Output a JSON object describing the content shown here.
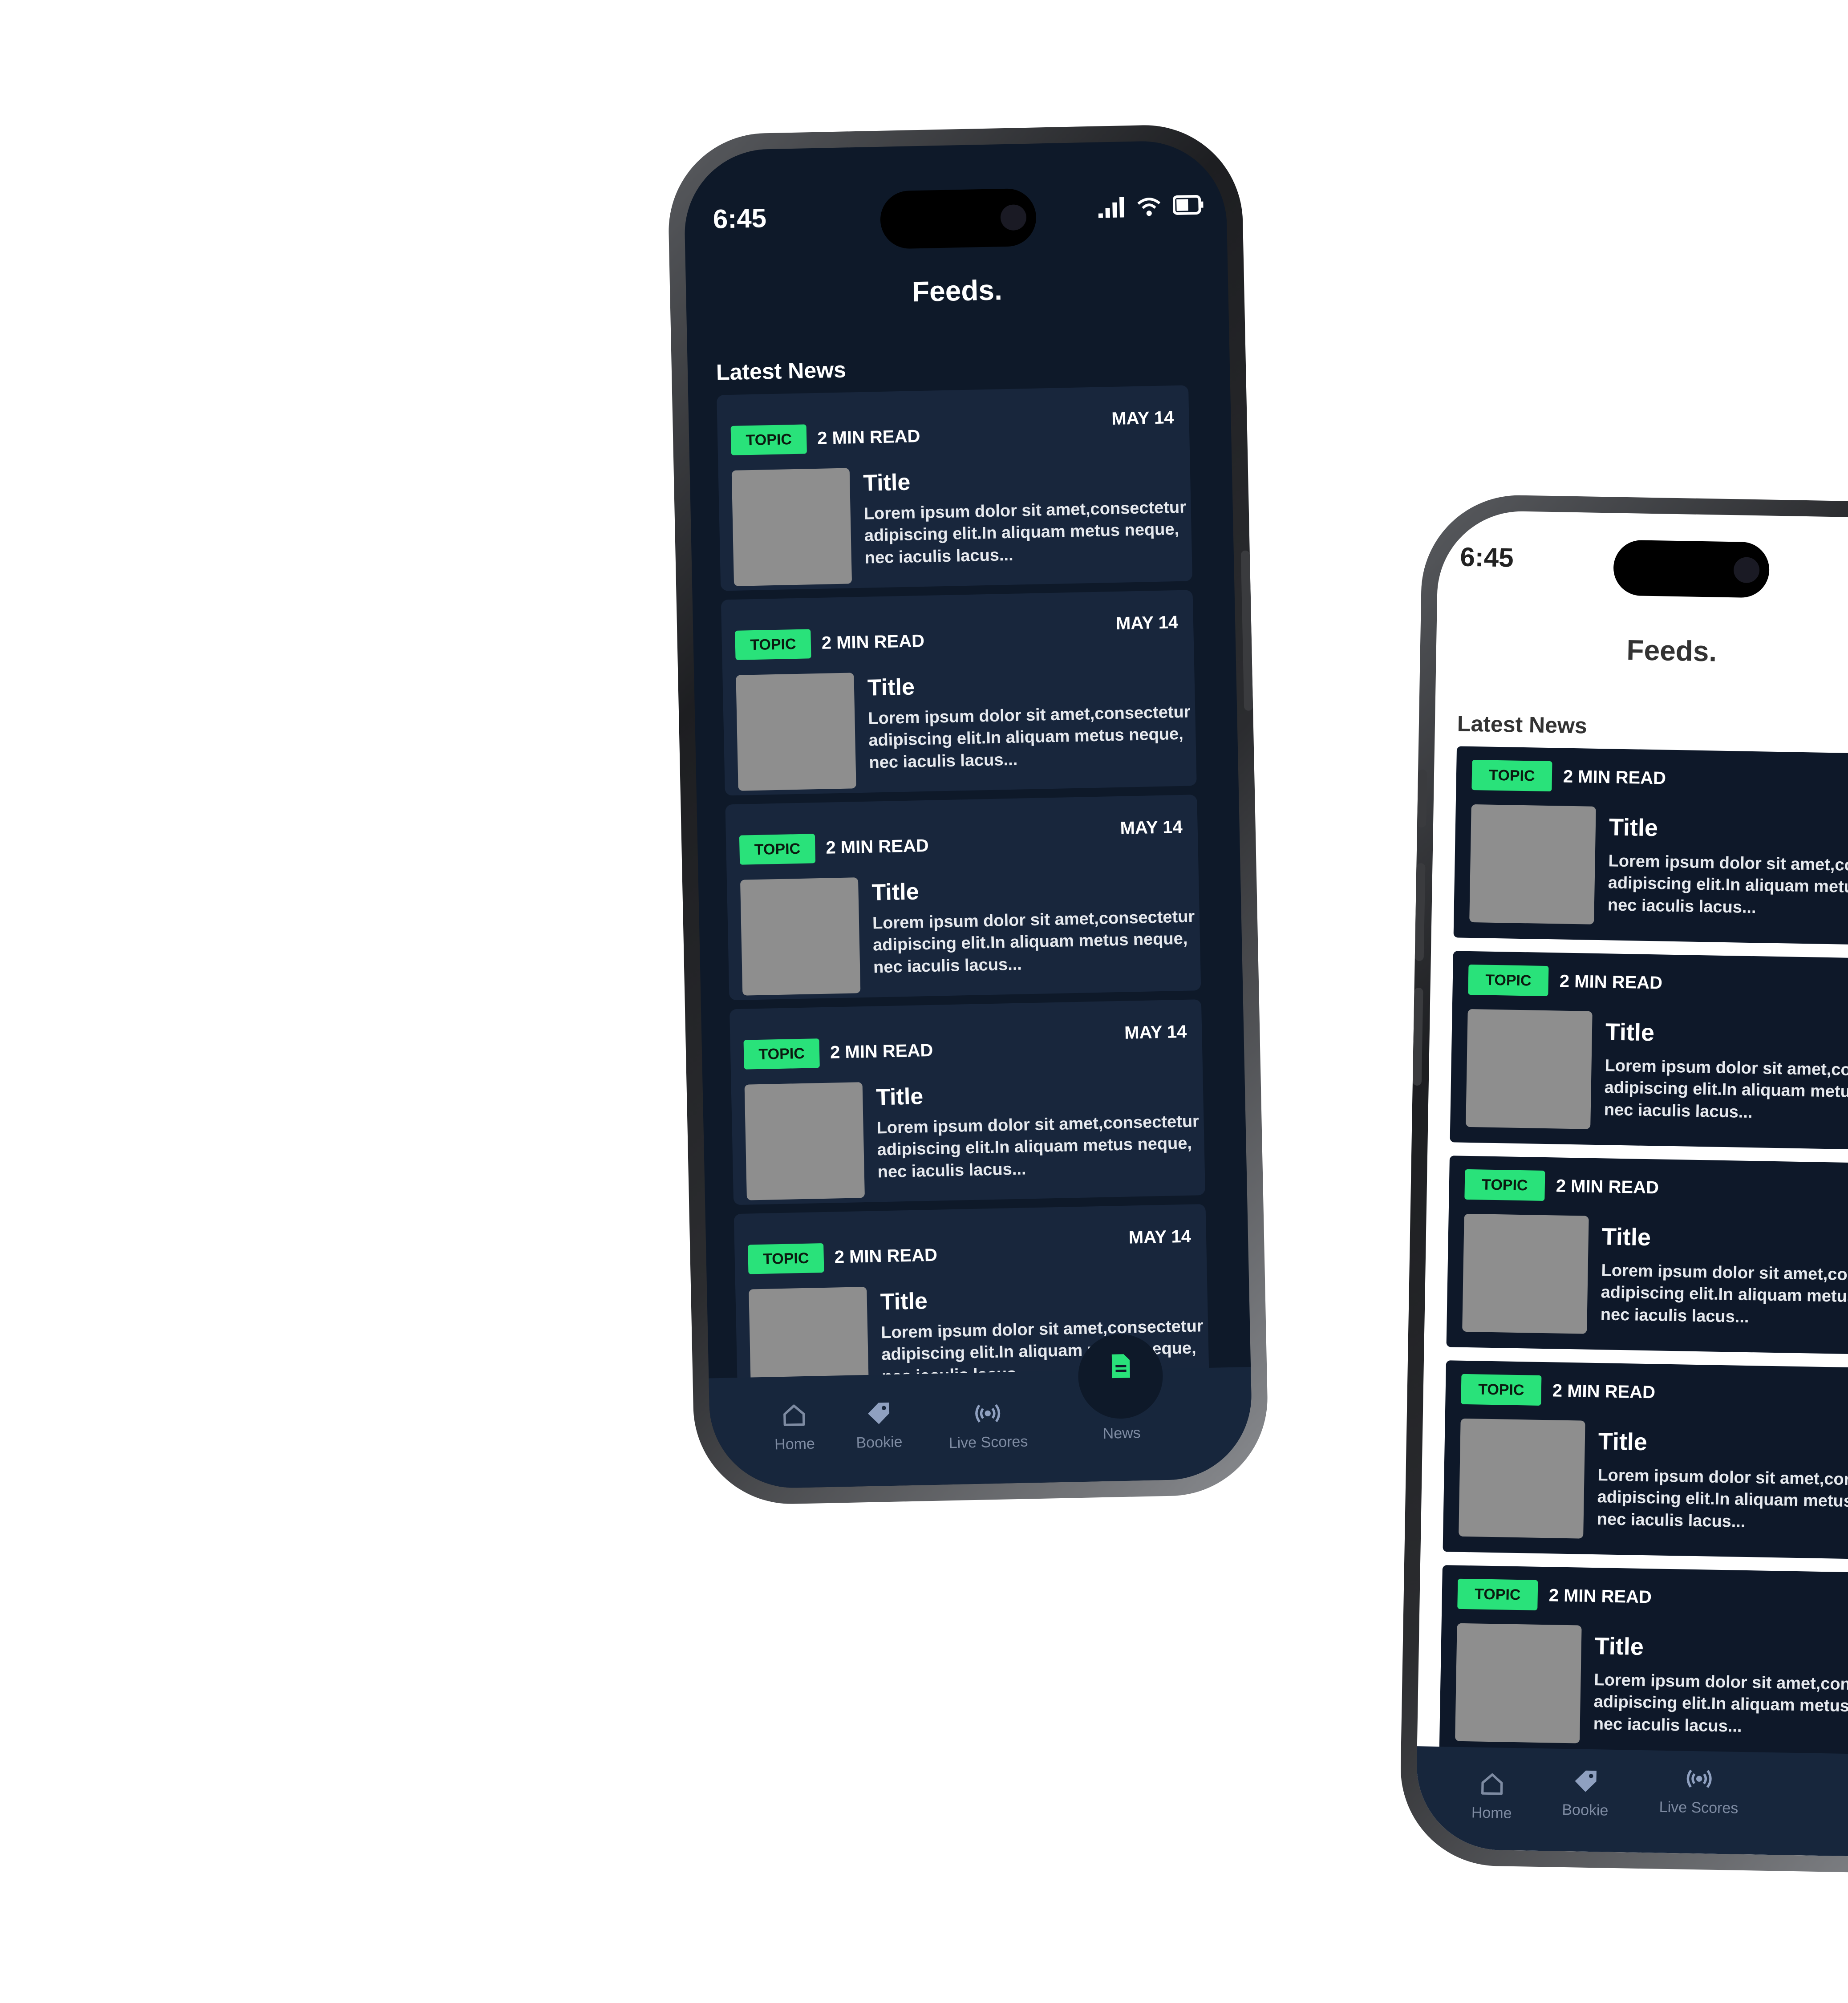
{
  "colors": {
    "screen_bg": "#0f1a2b",
    "card_bg": "#18263c",
    "topic_bg": "#29e27a",
    "nav_text": "#7e8ba2",
    "nav_active": "#29e27a"
  },
  "status": {
    "time": "6:45"
  },
  "app": {
    "title": "Feeds.",
    "section": "Latest News"
  },
  "article": {
    "topic": "TOPIC",
    "read": "2 MIN READ",
    "date": "MAY 14",
    "title": "Title",
    "desc_line1": "Lorem ipsum dolor sit amet,consectetur",
    "desc_line2": "adipiscing  elit.In aliquam metus neque,",
    "desc_line3": "nec iaculis lacus..."
  },
  "nav": {
    "home": "Home",
    "bookie": "Bookie",
    "live": "Live Scores",
    "news": "News",
    "icons": [
      "home-icon",
      "tag-icon",
      "broadcast-icon",
      "document-icon"
    ]
  }
}
